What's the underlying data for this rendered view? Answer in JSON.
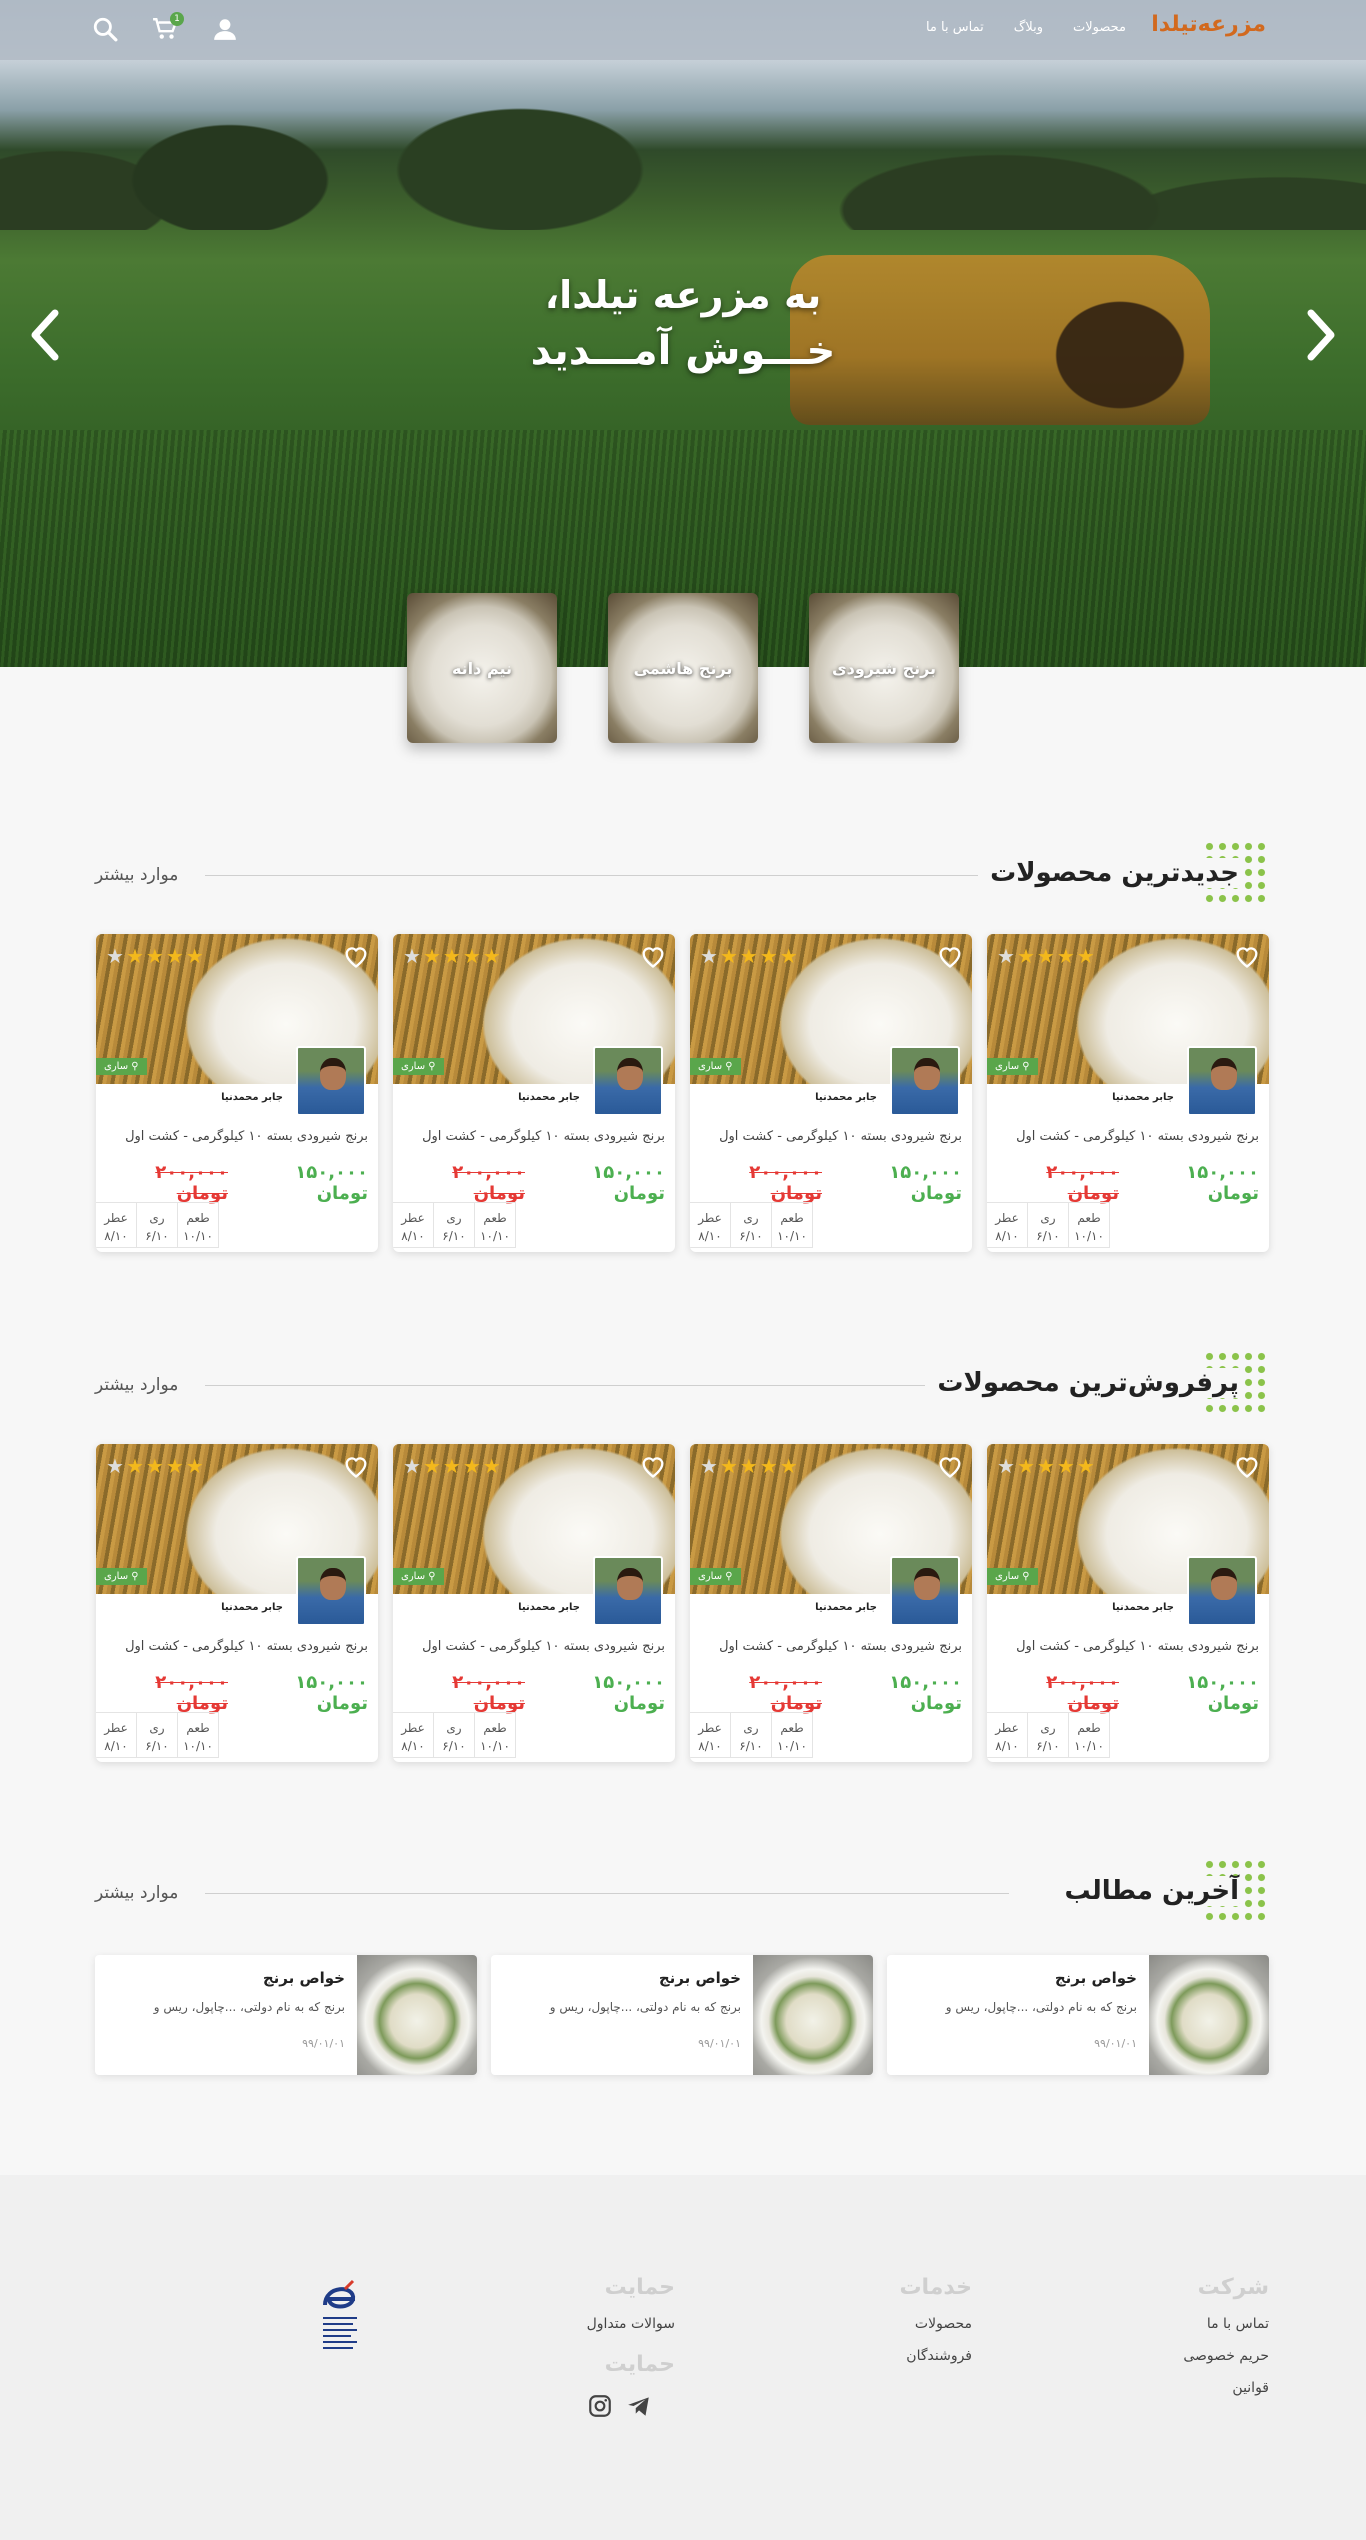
{
  "header": {
    "logo": "مزرعه‌تیلدا",
    "nav": [
      "محصولات",
      "وبلاگ",
      "تماس با ما"
    ],
    "cart_count": "1"
  },
  "hero": {
    "title_line1": "به مزرعه تیلدا،",
    "title_line2": "خـــوش آمـــدید"
  },
  "categories": [
    "برنج شیرودی",
    "برنج هاشمی",
    "نیم دانه"
  ],
  "sections": {
    "newest": {
      "title": "جدیدترین محصولات",
      "more": "موارد بیشتر"
    },
    "bestsellers": {
      "title": "پرفروش‌ترین محصولات",
      "more": "موارد بیشتر"
    },
    "blog": {
      "title": "آخرین مطالب",
      "more": "موارد بیشتر"
    }
  },
  "product": {
    "rating": 4,
    "rating_max": 5,
    "location": "ساری",
    "seller": "جابر محمدنیا",
    "name": "برنج شیرودی بسته ۱۰ کیلوگرمی - کشت اول",
    "price_new": "۱۵۰,۰۰۰ تومان",
    "price_old": "۲۰۰,۰۰۰ تومان",
    "specs": [
      {
        "label": "طعم",
        "value": "۱۰/۱۰"
      },
      {
        "label": "ری",
        "value": "۶/۱۰"
      },
      {
        "label": "عطر",
        "value": "۸/۱۰"
      }
    ]
  },
  "post": {
    "title": "خواص برنج",
    "desc": "برنج که به نام دولتی، ...چاپول، ریس و",
    "date": "۹۹/۰۱/۰۱"
  },
  "footer": {
    "col1": {
      "title": "شرکت",
      "links": [
        "تماس با ما",
        "حریم خصوصی",
        "قوانین"
      ]
    },
    "col2": {
      "title": "خدمات",
      "links": [
        "محصولات",
        "فروشندگان"
      ]
    },
    "col3": {
      "title": "حمایت",
      "links": [
        "سوالات متداول"
      ]
    },
    "col4": {
      "title": "حمایت"
    }
  },
  "colors": {
    "accent": "#5aa64b",
    "price_new": "#4caf50",
    "price_old": "#e53935",
    "star": "#f3b81c"
  }
}
